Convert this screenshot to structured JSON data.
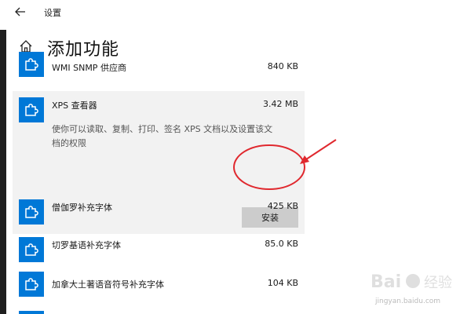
{
  "window": {
    "title": "设置"
  },
  "page": {
    "title": "添加功能"
  },
  "features": [
    {
      "name": "WMI SNMP 供应商",
      "size": "840 KB"
    },
    {
      "name": "XPS 查看器",
      "size": "3.42 MB",
      "description": "使你可以读取、复制、打印、签名 XPS 文档以及设置该文档的权限",
      "install_label": "安装",
      "selected": true
    },
    {
      "name": "僧伽罗补充字体",
      "size": "425 KB"
    },
    {
      "name": "切罗基语补充字体",
      "size": "85.0 KB"
    },
    {
      "name": "加拿大土著语音符号补充字体",
      "size": "104 KB"
    }
  ],
  "watermark": {
    "url_text": "jingyan.baidu.com"
  },
  "colors": {
    "tile_blue": "#0078d7",
    "selected_bg": "#f2f2f2",
    "annotation_red": "#e0282e",
    "install_button": "#cccccc"
  },
  "icons": {
    "back": "back-arrow-icon",
    "home": "home-icon",
    "feature": "puzzle-piece-icon"
  }
}
